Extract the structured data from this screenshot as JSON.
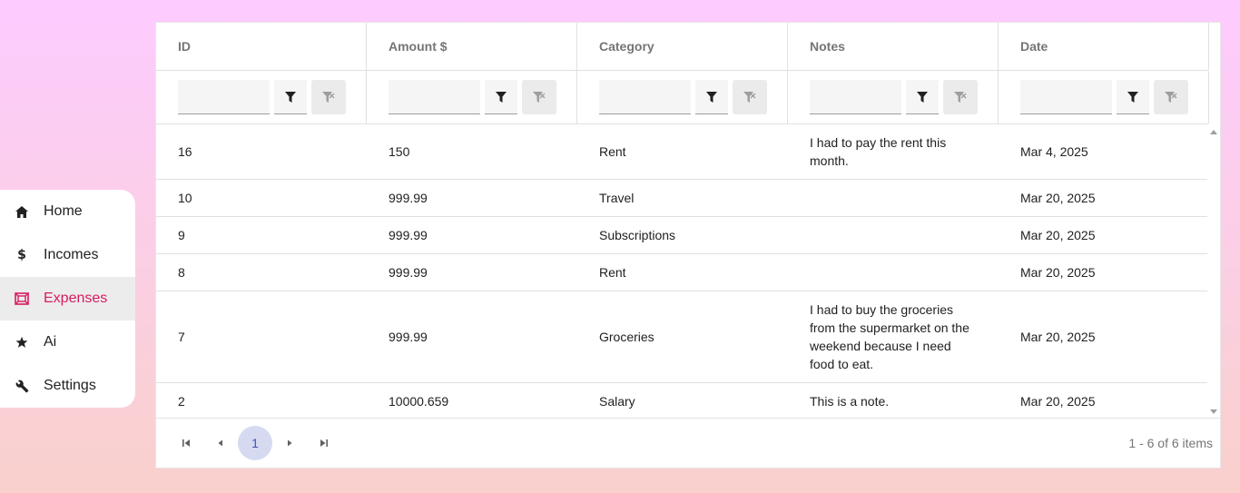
{
  "sidebar": {
    "items": [
      {
        "label": "Home",
        "icon": "home-icon",
        "active": false
      },
      {
        "label": "Incomes",
        "icon": "dollar-icon",
        "active": false
      },
      {
        "label": "Expenses",
        "icon": "receipt-icon",
        "active": true
      },
      {
        "label": "Ai",
        "icon": "star-icon",
        "active": false
      },
      {
        "label": "Settings",
        "icon": "wrench-icon",
        "active": false
      }
    ],
    "accent_color": "#d81b60"
  },
  "grid": {
    "columns": [
      "ID",
      "Amount $",
      "Category",
      "Notes",
      "Date"
    ],
    "rows": [
      {
        "id": "16",
        "amount": "150",
        "category": "Rent",
        "notes": "I had to pay the rent this month.",
        "date": "Mar 4, 2025"
      },
      {
        "id": "10",
        "amount": "999.99",
        "category": "Travel",
        "notes": "",
        "date": "Mar 20, 2025"
      },
      {
        "id": "9",
        "amount": "999.99",
        "category": "Subscriptions",
        "notes": "",
        "date": "Mar 20, 2025"
      },
      {
        "id": "8",
        "amount": "999.99",
        "category": "Rent",
        "notes": "",
        "date": "Mar 20, 2025"
      },
      {
        "id": "7",
        "amount": "999.99",
        "category": "Groceries",
        "notes": "I had to buy the groceries from the supermarket on the weekend because I need food to eat.",
        "date": "Mar 20, 2025"
      },
      {
        "id": "2",
        "amount": "10000.659",
        "category": "Salary",
        "notes": "This is a note.",
        "date": "Mar 20, 2025"
      }
    ]
  },
  "pager": {
    "current_page": "1",
    "info": "1 - 6 of 6 items"
  }
}
